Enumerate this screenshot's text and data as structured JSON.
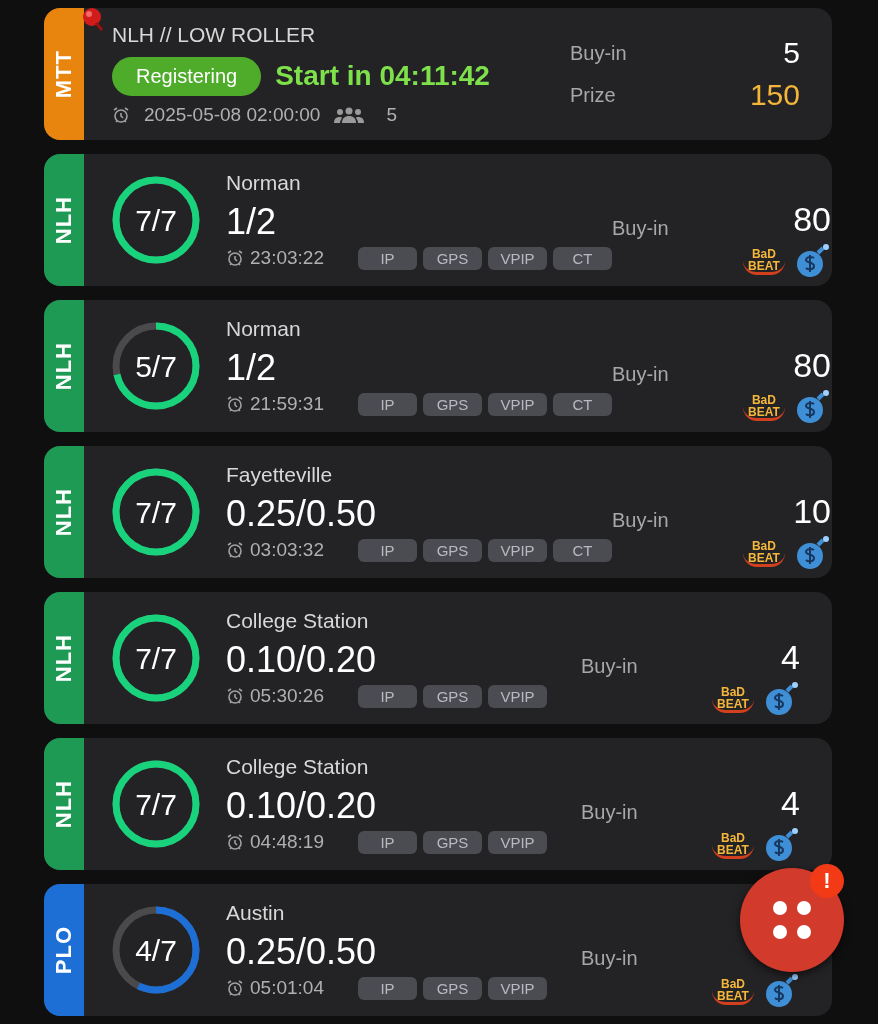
{
  "tournament": {
    "tag": "MTT",
    "color": "#e8850f",
    "pinned": true,
    "name": "NLH // LOW ROLLER",
    "status": "Registering",
    "countdown": "Start in 04:11:42",
    "date": "2025-05-08 02:00:00",
    "players": "5",
    "buyin_label": "Buy-in",
    "buyin": "5",
    "prize_label": "Prize",
    "prize": "150"
  },
  "tables": [
    {
      "tag": "NLH",
      "color": "#1f9a55",
      "seats": "7/7",
      "city": "Norman",
      "stakes": "1/2",
      "time": "23:03:22",
      "chips": [
        "IP",
        "GPS",
        "VPIP",
        "CT"
      ],
      "buyin_label": "Buy-in",
      "buyin": "80",
      "badge": "BaD BEAT"
    },
    {
      "tag": "NLH",
      "color": "#1f9a55",
      "seats": "5/7",
      "city": "Norman",
      "stakes": "1/2",
      "time": "21:59:31",
      "chips": [
        "IP",
        "GPS",
        "VPIP",
        "CT"
      ],
      "buyin_label": "Buy-in",
      "buyin": "80",
      "badge": "BaD BEAT"
    },
    {
      "tag": "NLH",
      "color": "#1f9a55",
      "seats": "7/7",
      "city": "Fayetteville",
      "stakes": "0.25/0.50",
      "time": "03:03:32",
      "chips": [
        "IP",
        "GPS",
        "VPIP",
        "CT"
      ],
      "buyin_label": "Buy-in",
      "buyin": "10",
      "badge": "BaD BEAT"
    },
    {
      "tag": "NLH",
      "color": "#1f9a55",
      "seats": "7/7",
      "city": "College Station",
      "stakes": "0.10/0.20",
      "time": "05:30:26",
      "chips": [
        "IP",
        "GPS",
        "VPIP"
      ],
      "buyin_label": "Buy-in",
      "buyin": "4",
      "badge": "BaD BEAT"
    },
    {
      "tag": "NLH",
      "color": "#1f9a55",
      "seats": "7/7",
      "city": "College Station",
      "stakes": "0.10/0.20",
      "time": "04:48:19",
      "chips": [
        "IP",
        "GPS",
        "VPIP"
      ],
      "buyin_label": "Buy-in",
      "buyin": "4",
      "badge": "BaD BEAT"
    },
    {
      "tag": "PLO",
      "color": "#1d6fd6",
      "seats": "4/7",
      "city": "Austin",
      "stakes": "0.25/0.50",
      "time": "05:01:04",
      "chips": [
        "IP",
        "GPS",
        "VPIP"
      ],
      "buyin_label": "Buy-in",
      "badge": "BaD BEAT"
    }
  ],
  "fab": {
    "alert": "!"
  }
}
